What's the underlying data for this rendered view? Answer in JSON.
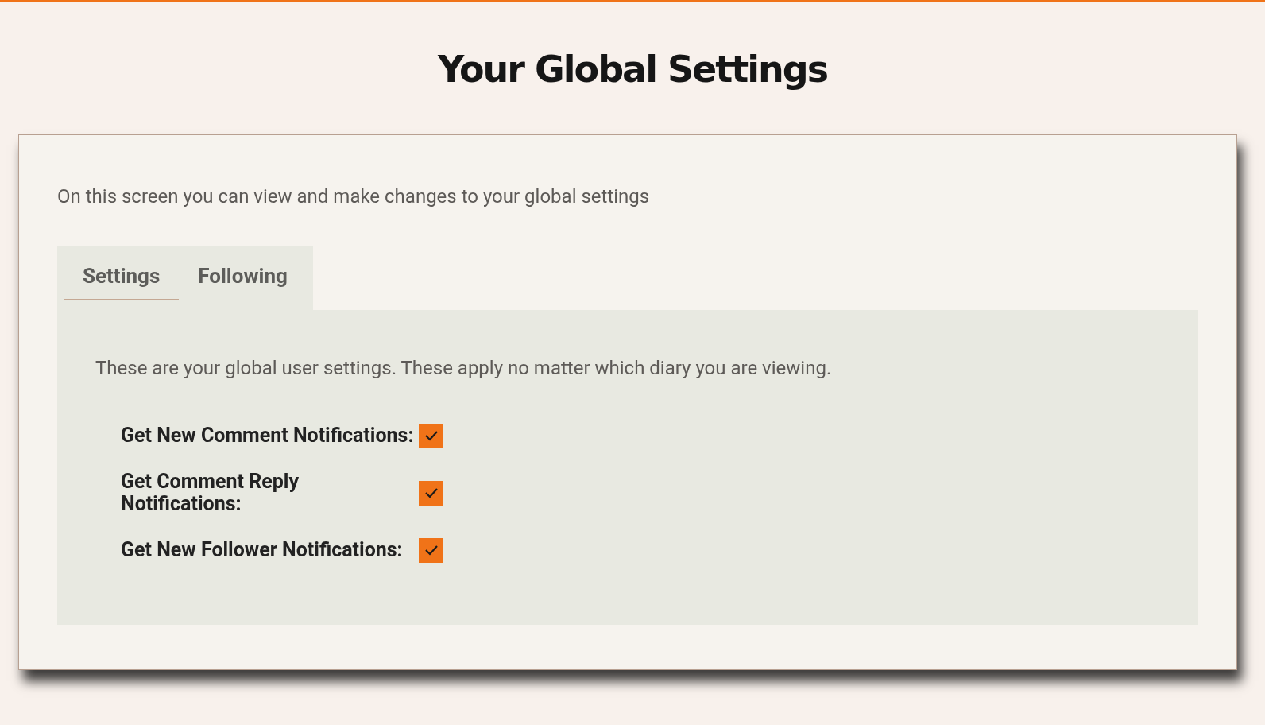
{
  "title": "Your Global Settings",
  "intro": "On this screen you can view and make changes to your global settings",
  "tabs": [
    {
      "label": "Settings",
      "selected": true
    },
    {
      "label": "Following",
      "selected": false
    }
  ],
  "panel": {
    "description": "These are your global user settings. These apply no matter which diary you are viewing.",
    "options": [
      {
        "label": "Get New Comment Notifications:",
        "checked": true
      },
      {
        "label": "Get Comment Reply Notifications:",
        "checked": true
      },
      {
        "label": "Get New Follower Notifications:",
        "checked": true
      }
    ]
  }
}
